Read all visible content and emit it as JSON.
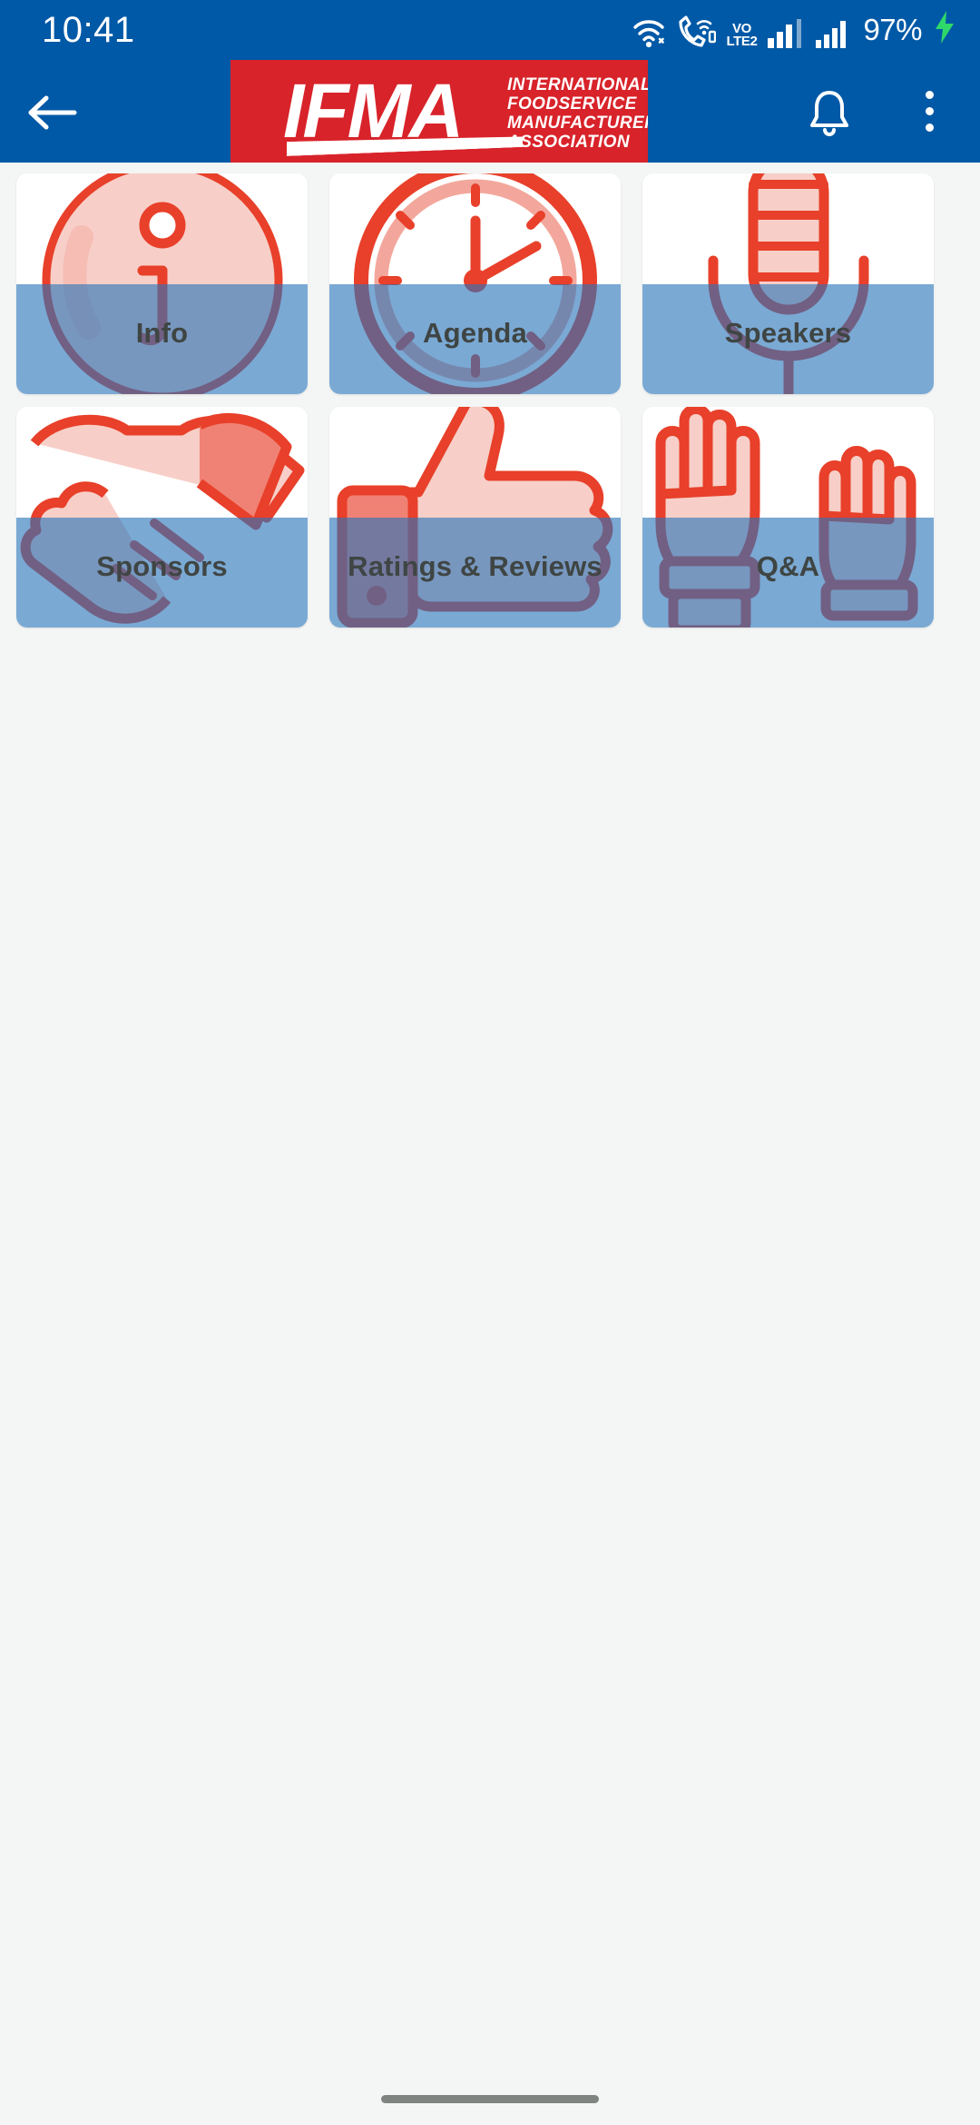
{
  "status_bar": {
    "time": "10:41",
    "battery_percent": "97%",
    "volte_top": "VO",
    "volte_bottom": "LTE",
    "volte_sim": "2",
    "icons": [
      "wifi-icon",
      "wifi-calling-icon",
      "volte-icon",
      "signal-bars-sim1-icon",
      "signal-bars-sim2-icon",
      "battery-charging-icon"
    ]
  },
  "app_bar": {
    "back_icon": "back-arrow-icon",
    "notifications_icon": "bell-icon",
    "overflow_icon": "kebab-menu-icon",
    "logo": {
      "wordmark": "IFMA",
      "tagline_line1": "INTERNATIONAL",
      "tagline_line2": "FOODSERVICE",
      "tagline_line3": "MANUFACTURERS",
      "tagline_line4": "ASSOCIATION"
    }
  },
  "theme": {
    "brand_blue": "#0059a6",
    "brand_red": "#d8232a",
    "tile_band_blue": "#2974ba",
    "icon_red": "#e8402a",
    "icon_fill": "#f7cfc8",
    "page_bg": "#f4f6f5",
    "label_text": "#3f4543"
  },
  "grid": {
    "tiles": [
      {
        "label": "Info",
        "icon": "info-circle-icon"
      },
      {
        "label": "Agenda",
        "icon": "clock-icon"
      },
      {
        "label": "Speakers",
        "icon": "microphone-icon"
      },
      {
        "label": "Sponsors",
        "icon": "handshake-icon"
      },
      {
        "label": "Ratings & Reviews",
        "icon": "thumbs-up-icon"
      },
      {
        "label": "Q&A",
        "icon": "raised-hands-icon"
      }
    ]
  },
  "navigation_bar": {
    "gesture_pill": "home-gesture-pill"
  }
}
